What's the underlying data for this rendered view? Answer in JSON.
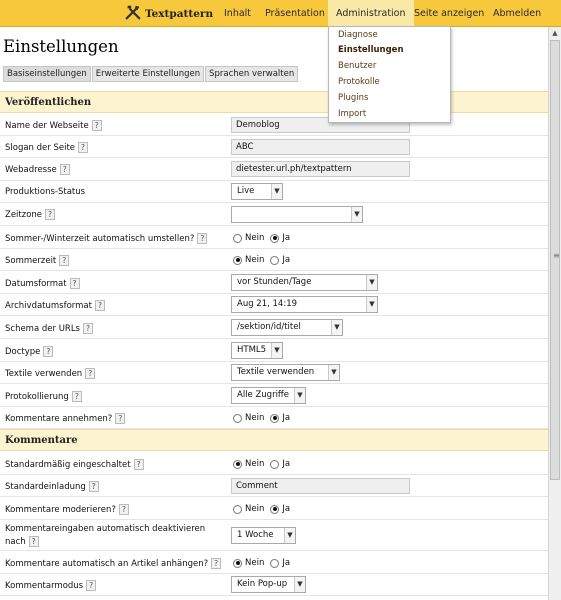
{
  "topbar": {
    "brand": "Textpattern",
    "nav": [
      "Inhalt",
      "Präsentation",
      "Administration",
      "Seite anzeigen",
      "Abmelden"
    ]
  },
  "menu": [
    "Diagnose",
    "Einstellungen",
    "Benutzer",
    "Protokolle",
    "Plugins",
    "Import"
  ],
  "page": {
    "title": "Einstellungen",
    "tabs": [
      "Basiseinstellungen",
      "Erweiterte Einstellungen",
      "Sprachen verwalten"
    ]
  },
  "help": "?",
  "radio_labels": {
    "no": "Nein",
    "yes": "Ja"
  },
  "sections": {
    "publish": "Veröffentlichen",
    "comments": "Kommentare"
  },
  "fields": {
    "site_name": {
      "label": "Name der Webseite",
      "value": "Demoblog"
    },
    "slogan": {
      "label": "Slogan der Seite",
      "value": "ABC"
    },
    "url": {
      "label": "Webadresse",
      "value": "dietester.url.ph/textpattern"
    },
    "prod_status": {
      "label": "Produktions-Status",
      "value": "Live"
    },
    "timezone": {
      "label": "Zeitzone",
      "value": ""
    },
    "dst_auto": {
      "label": "Sommer-/Winterzeit automatisch umstellen?",
      "value": "Ja"
    },
    "dst": {
      "label": "Sommerzeit",
      "value": "Nein"
    },
    "date_format": {
      "label": "Datumsformat",
      "value": "vor Stunden/Tage"
    },
    "archive_format": {
      "label": "Archivdatumsformat",
      "value": "Aug 21, 14:19"
    },
    "url_schema": {
      "label": "Schema der URLs",
      "value": "/sektion/id/titel"
    },
    "doctype": {
      "label": "Doctype",
      "value": "HTML5"
    },
    "textile": {
      "label": "Textile verwenden",
      "value": "Textile verwenden"
    },
    "logging": {
      "label": "Protokollierung",
      "value": "Alle Zugriffe"
    },
    "accept_comments": {
      "label": "Kommentare annehmen?",
      "value": "Ja"
    },
    "default_on": {
      "label": "Standardmäßig eingeschaltet",
      "value": "Nein"
    },
    "default_invite": {
      "label": "Standardeinladung",
      "value": "Comment"
    },
    "moderate": {
      "label": "Kommentare moderieren?",
      "value": "Ja"
    },
    "auto_disable": {
      "label": "Kommentareingaben automatisch deaktivieren nach",
      "value": "1 Woche"
    },
    "auto_append": {
      "label": "Kommentare automatisch an Artikel anhängen?",
      "value": "Nein"
    },
    "comment_mode": {
      "label": "Kommentarmodus",
      "value": "Kein Pop-up"
    }
  }
}
